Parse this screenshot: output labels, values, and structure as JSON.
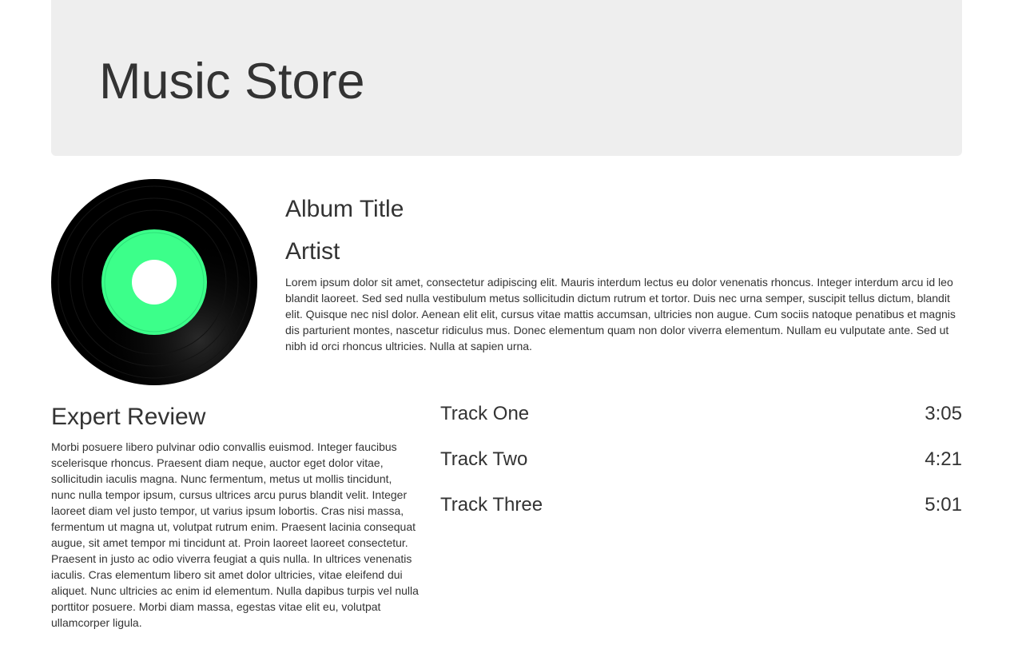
{
  "header": {
    "title": "Music Store"
  },
  "album": {
    "art_icon": "vinyl-record-icon",
    "label_color": "#3cff8a",
    "title": "Album Title",
    "artist": "Artist",
    "description": "Lorem ipsum dolor sit amet, consectetur adipiscing elit. Mauris interdum lectus eu dolor venenatis rhoncus. Integer interdum arcu id leo blandit laoreet. Sed sed nulla vestibulum metus sollicitudin dictum rutrum et tortor. Duis nec urna semper, suscipit tellus dictum, blandit elit. Quisque nec nisl dolor. Aenean elit elit, cursus vitae mattis accumsan, ultricies non augue. Cum sociis natoque penatibus et magnis dis parturient montes, nascetur ridiculus mus. Donec elementum quam non dolor viverra elementum. Nullam eu vulputate ante. Sed ut nibh id orci rhoncus ultricies. Nulla at sapien urna."
  },
  "review": {
    "heading": "Expert Review",
    "text": "Morbi posuere libero pulvinar odio convallis euismod. Integer faucibus scelerisque rhoncus. Praesent diam neque, auctor eget dolor vitae, sollicitudin iaculis magna. Nunc fermentum, metus ut mollis tincidunt, nunc nulla tempor ipsum, cursus ultrices arcu purus blandit velit. Integer laoreet diam vel justo tempor, ut varius ipsum lobortis. Cras nisi massa, fermentum ut magna ut, volutpat rutrum enim. Praesent lacinia consequat augue, sit amet tempor mi tincidunt at. Proin laoreet laoreet consectetur. Praesent in justo ac odio viverra feugiat a quis nulla. In ultrices venenatis iaculis. Cras elementum libero sit amet dolor ultricies, vitae eleifend dui aliquet. Nunc ultricies ac enim id elementum. Nulla dapibus turpis vel nulla porttitor posuere. Morbi diam massa, egestas vitae elit eu, volutpat ullamcorper ligula."
  },
  "tracks": [
    {
      "name": "Track One",
      "time": "3:05"
    },
    {
      "name": "Track Two",
      "time": "4:21"
    },
    {
      "name": "Track Three",
      "time": "5:01"
    }
  ]
}
